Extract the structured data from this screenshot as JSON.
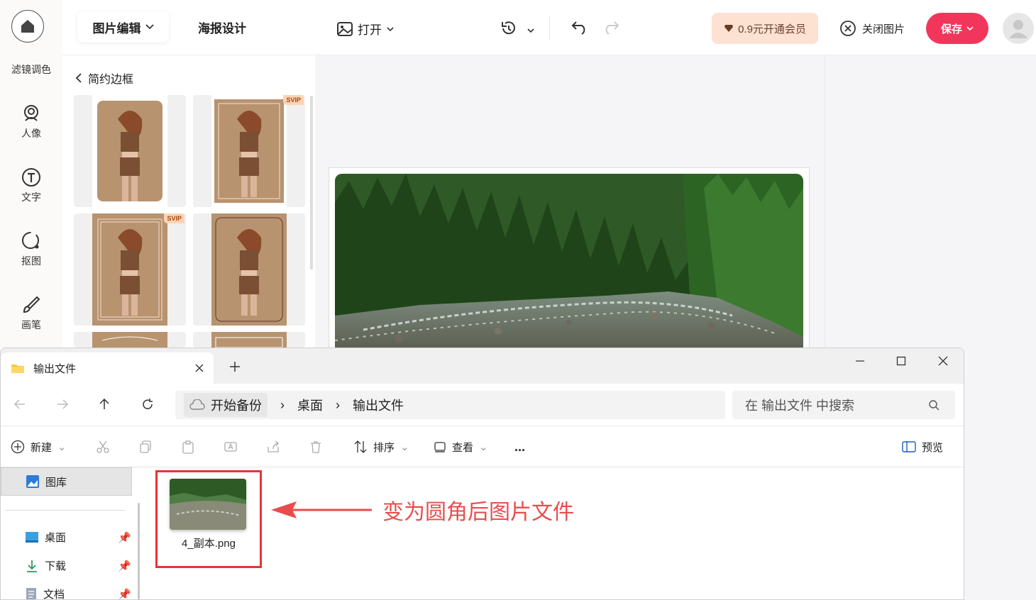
{
  "left_toolbar": {
    "items": [
      {
        "label": "滤镜调色",
        "icon": "filter-icon"
      },
      {
        "label": "人像",
        "icon": "portrait-icon"
      },
      {
        "label": "文字",
        "icon": "text-icon"
      },
      {
        "label": "抠图",
        "icon": "cutout-icon"
      },
      {
        "label": "画笔",
        "icon": "brush-icon"
      }
    ]
  },
  "header": {
    "tab_edit": "图片编辑",
    "tab_poster": "海报设计",
    "open_label": "打开",
    "vip_label": "0.9元开通会员",
    "close_image_label": "关闭图片",
    "save_label": "保存"
  },
  "panel": {
    "back_label": "简约边框",
    "badge": "SVIP"
  },
  "colors": {
    "accent": "#f2365b",
    "vip_bg": "#fde1d1",
    "annotation": "#e84d4d"
  },
  "explorer": {
    "tab_title": "输出文件",
    "breadcrumb": [
      "开始备份",
      "桌面",
      "输出文件"
    ],
    "search_placeholder": "在 输出文件 中搜索",
    "commands": {
      "new": "新建",
      "sort": "排序",
      "view": "查看",
      "more": "...",
      "preview": "预览"
    },
    "sidebar": {
      "gallery": "图库",
      "desktop": "桌面",
      "downloads": "下载",
      "documents": "文档"
    },
    "file_name": "4_副本.png",
    "annotation": "变为圆角后图片文件"
  }
}
